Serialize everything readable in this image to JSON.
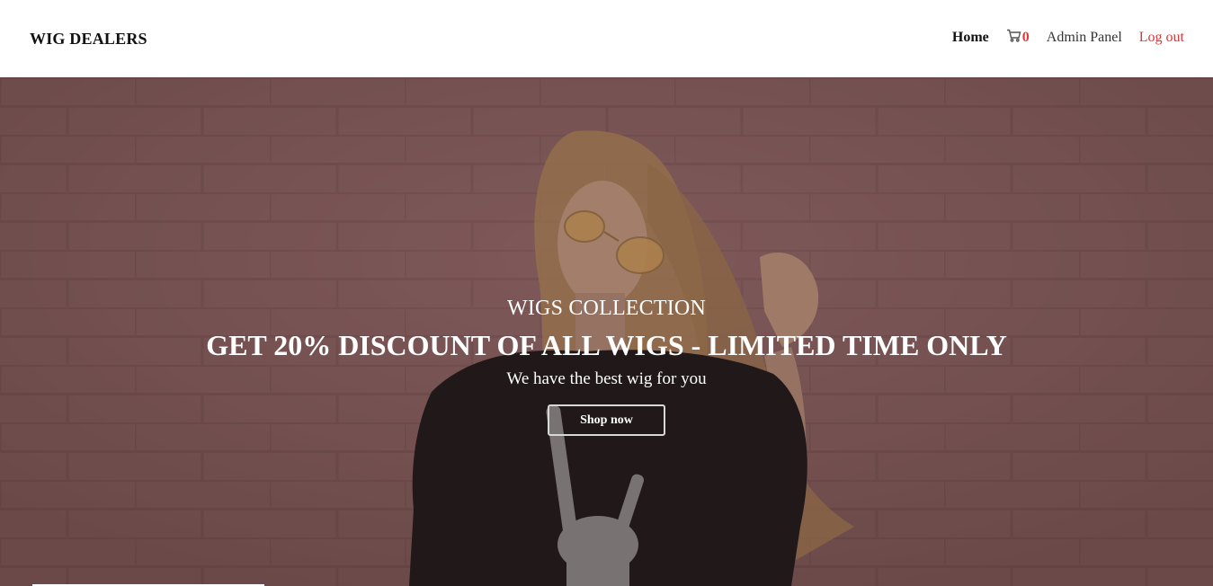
{
  "header": {
    "brand": "WIG DEALERS",
    "nav": {
      "home": "Home",
      "cart_count": "0",
      "admin": "Admin Panel",
      "logout": "Log out"
    }
  },
  "hero": {
    "eyebrow": "WIGS COLLECTION",
    "headline": "GET 20% DISCOUNT OF ALL WIGS - LIMITED TIME ONLY",
    "subline": "We have the best wig for you",
    "cta_label": "Shop now"
  },
  "icons": {
    "cart": "shopping-cart-icon"
  },
  "colors": {
    "accent_red": "#d93636",
    "hero_overlay": "#7c5454"
  }
}
